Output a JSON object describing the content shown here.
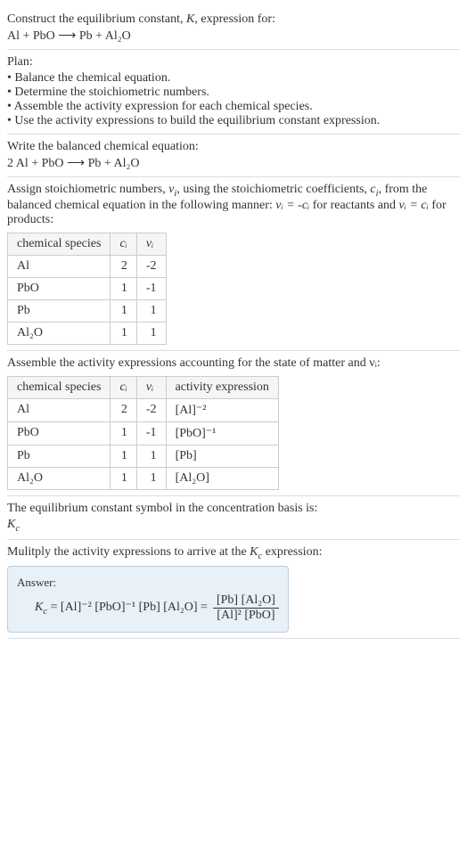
{
  "intro": {
    "line1_prefix": "Construct the equilibrium constant, ",
    "line1_var": "K",
    "line1_suffix": ", expression for:",
    "equation": "Al + PbO ⟶ Pb + Al₂O"
  },
  "plan": {
    "title": "Plan:",
    "items": [
      "• Balance the chemical equation.",
      "• Determine the stoichiometric numbers.",
      "• Assemble the activity expression for each chemical species.",
      "• Use the activity expressions to build the equilibrium constant expression."
    ]
  },
  "balanced": {
    "title": "Write the balanced chemical equation:",
    "equation": "2 Al + PbO ⟶ Pb + Al₂O"
  },
  "stoich": {
    "text_p1": "Assign stoichiometric numbers, ",
    "text_nu": "ν",
    "text_i": "i",
    "text_p2": ", using the stoichiometric coefficients, ",
    "text_c": "c",
    "text_p3": ", from the balanced chemical equation in the following manner: ",
    "text_eq1": "νᵢ = -cᵢ",
    "text_p4": " for reactants and ",
    "text_eq2": "νᵢ = cᵢ",
    "text_p5": " for products:",
    "headers": {
      "species": "chemical species",
      "ci": "cᵢ",
      "nui": "νᵢ"
    },
    "rows": [
      {
        "species": "Al",
        "ci": "2",
        "nui": "-2"
      },
      {
        "species": "PbO",
        "ci": "1",
        "nui": "-1"
      },
      {
        "species": "Pb",
        "ci": "1",
        "nui": "1"
      },
      {
        "species": "Al₂O",
        "ci": "1",
        "nui": "1"
      }
    ]
  },
  "activity": {
    "title": "Assemble the activity expressions accounting for the state of matter and νᵢ:",
    "headers": {
      "species": "chemical species",
      "ci": "cᵢ",
      "nui": "νᵢ",
      "expr": "activity expression"
    },
    "rows": [
      {
        "species": "Al",
        "ci": "2",
        "nui": "-2",
        "expr": "[Al]⁻²"
      },
      {
        "species": "PbO",
        "ci": "1",
        "nui": "-1",
        "expr": "[PbO]⁻¹"
      },
      {
        "species": "Pb",
        "ci": "1",
        "nui": "1",
        "expr": "[Pb]"
      },
      {
        "species": "Al₂O",
        "ci": "1",
        "nui": "1",
        "expr": "[Al₂O]"
      }
    ]
  },
  "symbol": {
    "title": "The equilibrium constant symbol in the concentration basis is:",
    "value": "K",
    "valueSub": "c"
  },
  "multiply": {
    "title_p1": "Mulitply the activity expressions to arrive at the ",
    "title_kc": "K",
    "title_kcsub": "c",
    "title_p2": " expression:"
  },
  "answer": {
    "label": "Answer:",
    "kc": "K",
    "kcsub": "c",
    "expr_flat": " = [Al]⁻² [PbO]⁻¹ [Pb] [Al₂O] = ",
    "frac_num": "[Pb] [Al₂O]",
    "frac_den": "[Al]² [PbO]"
  }
}
